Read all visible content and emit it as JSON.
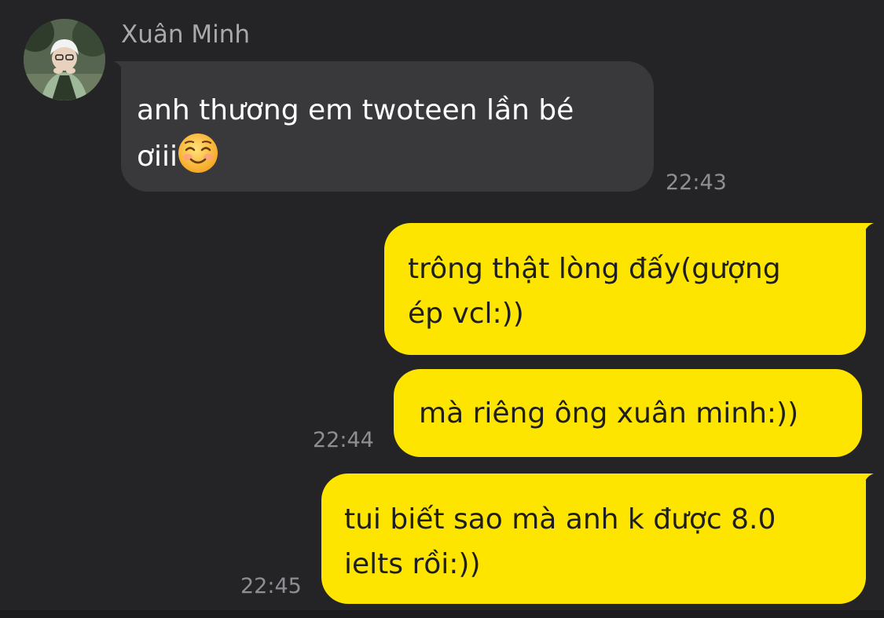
{
  "conversation": {
    "sender_name": "Xuân Minh",
    "messages": [
      {
        "direction": "incoming",
        "text": "anh thương em twoteen lần bé\nơiii",
        "emoji": "smiling-face-emoji",
        "time": "22:43"
      },
      {
        "direction": "outgoing",
        "text": "trông thật lòng đấy(gượng\nép vcl:))"
      },
      {
        "direction": "outgoing",
        "text": "mà riêng ông xuân minh:))",
        "time": "22:44"
      },
      {
        "direction": "outgoing",
        "text": "tui biết sao mà anh k được 8.0\nielts rồi:))",
        "time": "22:45"
      }
    ]
  },
  "colors": {
    "background": "#242427",
    "incoming_bubble": "#39393c",
    "outgoing_bubble": "#fee500",
    "timestamp": "#8e8e93",
    "sender_name": "#a9a9ad"
  }
}
